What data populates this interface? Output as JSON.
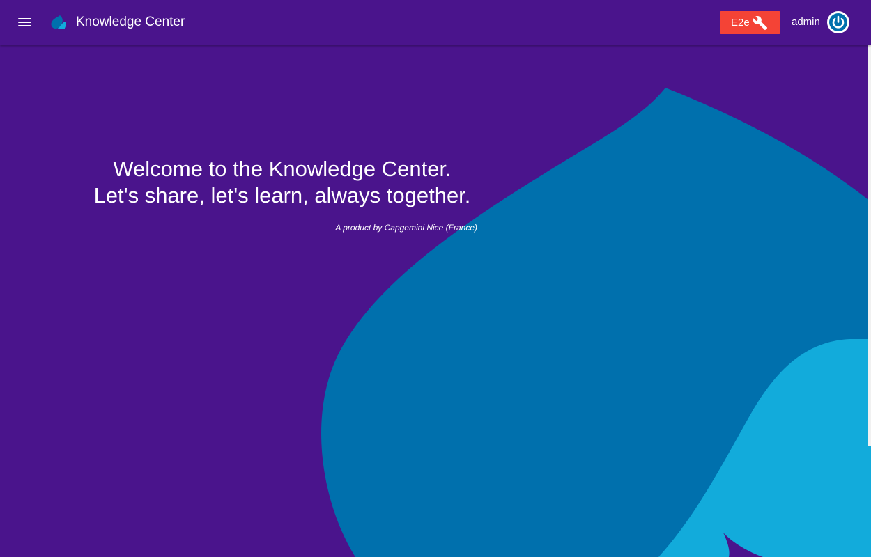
{
  "header": {
    "app_title": "Knowledge Center",
    "menu_icon": "hamburger-menu-icon",
    "logo_icon": "capgemini-spade-logo",
    "e2e_button_label": "E2e",
    "e2e_icon": "wrench-icon",
    "user_name": "admin",
    "power_icon": "power-icon"
  },
  "hero": {
    "line1": "Welcome to the Knowledge Center.",
    "line2": "Let's share, let's learn, always together.",
    "byline": "A product by Capgemini Nice (France)"
  },
  "colors": {
    "background": "#4a148c",
    "spade_dark": "#0070ad",
    "spade_light": "#12abdb",
    "e2e_button": "#f44336",
    "text": "#ffffff"
  }
}
